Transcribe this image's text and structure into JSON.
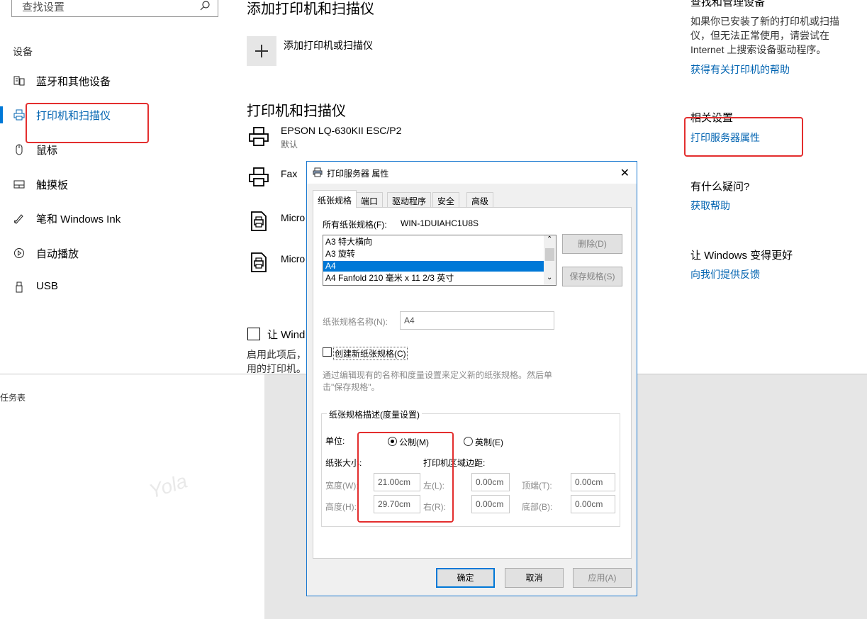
{
  "settings": {
    "search_placeholder": "查找设置",
    "nav_heading": "设备",
    "nav_items": [
      {
        "label": "蓝牙和其他设备",
        "icon": "bluetooth-devices-icon"
      },
      {
        "label": "打印机和扫描仪",
        "icon": "printer-icon"
      },
      {
        "label": "鼠标",
        "icon": "mouse-icon"
      },
      {
        "label": "触摸板",
        "icon": "touchpad-icon"
      },
      {
        "label": "笔和 Windows Ink",
        "icon": "pen-icon"
      },
      {
        "label": "自动播放",
        "icon": "autoplay-icon"
      },
      {
        "label": "USB",
        "icon": "usb-icon"
      }
    ],
    "add_section_title": "添加打印机和扫描仪",
    "add_button_label": "添加打印机或扫描仪",
    "printers_section_title": "打印机和扫描仪",
    "printers": [
      {
        "name": "EPSON LQ-630KII ESC/P2",
        "status": "默认"
      },
      {
        "name": "Fax",
        "status": ""
      },
      {
        "name": "Micro",
        "status": ""
      },
      {
        "name": "Micro",
        "status": ""
      }
    ],
    "let_windows_checkbox": "让 Wind",
    "bottom_text_line1": "启用此项后，",
    "bottom_text_line2": "用的打印机。",
    "taskbar_text": "任务表",
    "watermark": "Yola"
  },
  "right_panel": {
    "heading_top": "查找和管理设备",
    "text": "如果你已安装了新的打印机或扫描仪，但无法正常使用，请尝试在 Internet 上搜索设备驱动程序。",
    "help_link": "获得有关打印机的帮助",
    "related_heading": "相关设置",
    "server_props_link": "打印服务器属性",
    "question_heading": "有什么疑问?",
    "get_help_link": "获取帮助",
    "feedback_heading": "让 Windows 变得更好",
    "feedback_link": "向我们提供反馈"
  },
  "dialog": {
    "title": "打印服务器 属性",
    "tabs": [
      "纸张规格",
      "端口",
      "驱动程序",
      "安全",
      "高级"
    ],
    "all_forms_label": "所有纸张规格(F):",
    "server_name": "WIN-1DUIAHC1U8S",
    "form_list": [
      "A3 特大横向",
      "A3 旋转",
      "A4",
      "A4 Fanfold 210 毫米 x 11 2/3 英寸"
    ],
    "selected_form_index": 2,
    "delete_btn": "删除(D)",
    "save_form_btn": "保存规格(S)",
    "form_name_label": "纸张规格名称(N):",
    "form_name_value": "A4",
    "create_new_label": "创建新纸张规格(C)",
    "hint_line1": "通过编辑现有的名称和度量设置来定义新的纸张规格。然后单",
    "hint_line2": "击\"保存规格\"。",
    "group_title": "纸张规格描述(度量设置)",
    "unit_label": "单位:",
    "metric_label": "公制(M)",
    "english_label": "英制(E)",
    "paper_size_label": "纸张大小:",
    "margins_label": "打印机区域边距:",
    "width_label": "宽度(W):",
    "width_value": "21.00cm",
    "height_label": "高度(H):",
    "height_value": "29.70cm",
    "left_label": "左(L):",
    "left_value": "0.00cm",
    "right_label": "右(R):",
    "right_value": "0.00cm",
    "top_label": "顶端(T):",
    "top_value": "0.00cm",
    "bottom_label": "底部(B):",
    "bottom_value": "0.00cm",
    "ok_btn": "确定",
    "cancel_btn": "取消",
    "apply_btn": "应用(A)"
  },
  "colors": {
    "accent": "#0078d7",
    "link": "#0063b1",
    "highlight_red": "#e32e2e"
  }
}
